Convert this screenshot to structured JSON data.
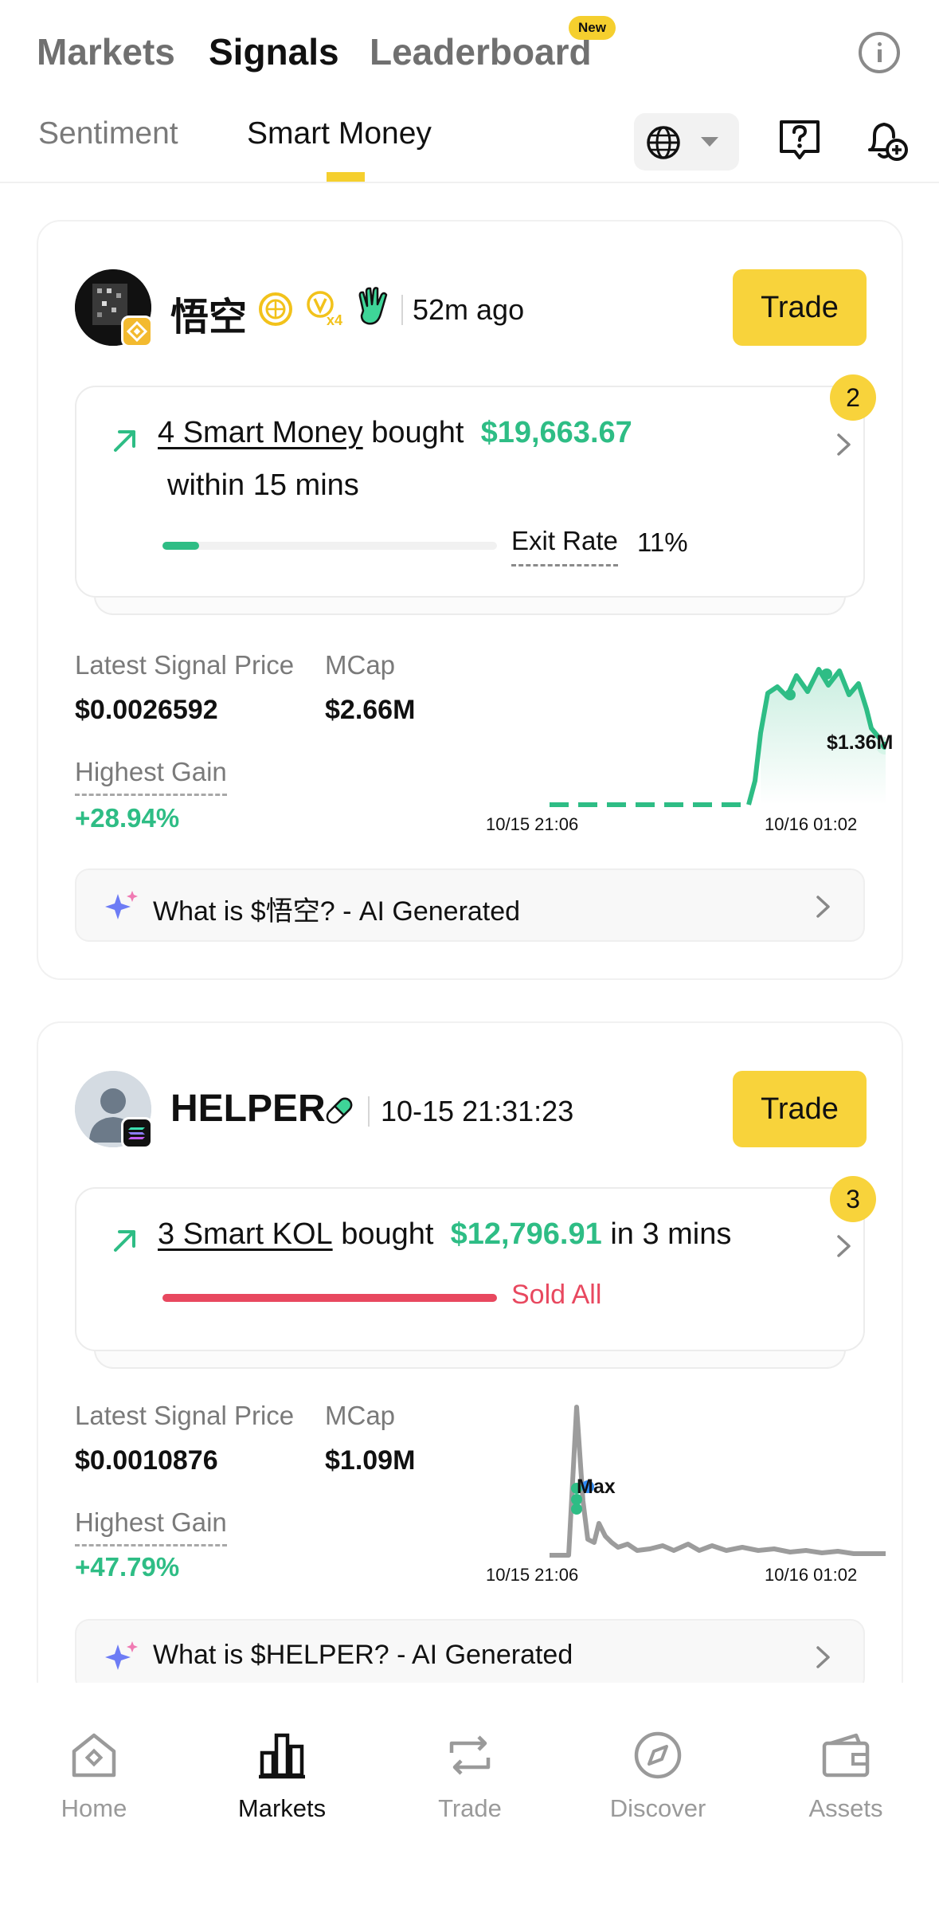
{
  "header": {
    "tabs": [
      "Markets",
      "Signals",
      "Leaderboard"
    ],
    "new_badge": "New",
    "sub_tabs": [
      "Sentiment",
      "Smart Money"
    ]
  },
  "cards": [
    {
      "name": "悟空",
      "time": "52m ago",
      "trade_label": "Trade",
      "count": "2",
      "signal": {
        "who": "4 Smart Money",
        "verb": "bought",
        "amount": "$19,663.67",
        "window": "within 15 mins",
        "exit_label": "Exit Rate",
        "exit_value": "11%",
        "exit_fraction": 0.11
      },
      "latest_label": "Latest Signal Price",
      "latest_value": "$0.0026592",
      "mcap_label": "MCap",
      "mcap_value": "$2.66M",
      "gain_label": "Highest Gain",
      "gain_value": "+28.94%",
      "chart": {
        "annotation": "$1.36M",
        "start": "10/15 21:06",
        "end": "10/16 01:02"
      },
      "ai_text": "What is $悟空? - AI Generated"
    },
    {
      "name": "HELPER",
      "time": "10-15 21:31:23",
      "trade_label": "Trade",
      "count": "3",
      "signal": {
        "who": "3 Smart KOL",
        "verb": "bought",
        "amount": "$12,796.91",
        "window": "in 3 mins",
        "status": "Sold All",
        "exit_fraction": 1.0
      },
      "latest_label": "Latest Signal Price",
      "latest_value": "$0.0010876",
      "mcap_label": "MCap",
      "mcap_value": "$1.09M",
      "gain_label": "Highest Gain",
      "gain_value": "+47.79%",
      "chart": {
        "annotation": "Max",
        "start": "10/15 21:06",
        "end": "10/16 01:02"
      },
      "ai_text": "What is $HELPER? - AI Generated"
    }
  ],
  "bottom_nav": [
    "Home",
    "Markets",
    "Trade",
    "Discover",
    "Assets"
  ],
  "colors": {
    "accent": "#f8d33b",
    "green": "#2ebd85",
    "red": "#e8485f"
  }
}
